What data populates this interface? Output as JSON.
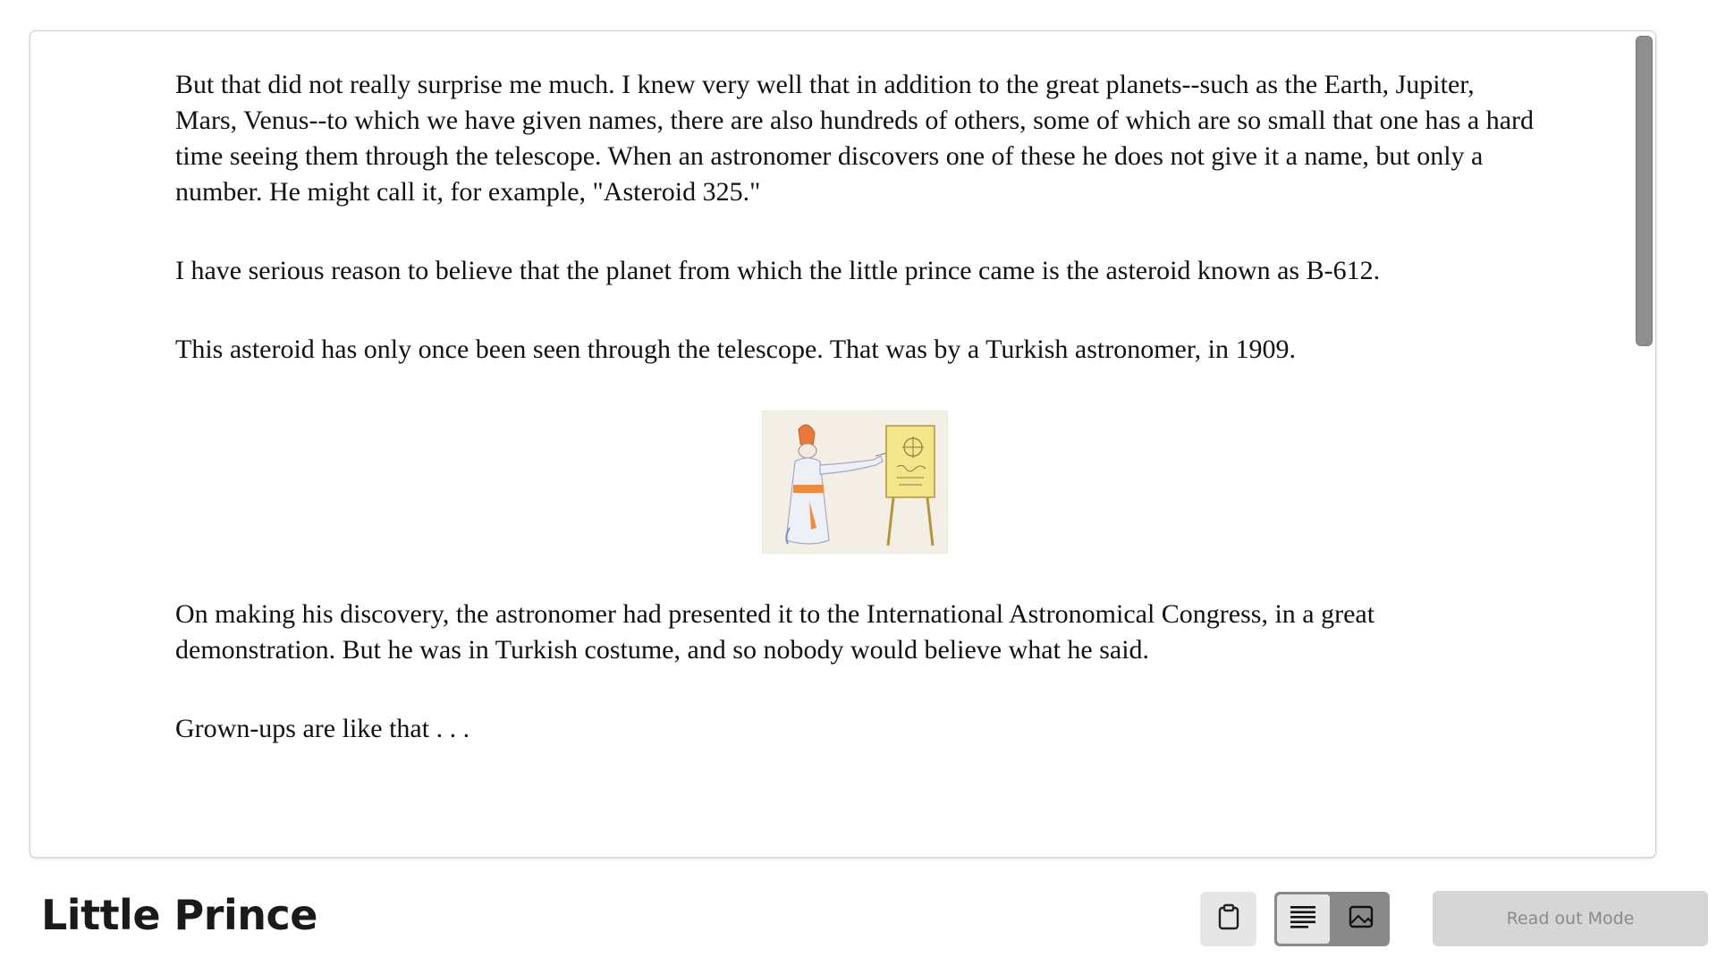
{
  "document": {
    "paragraphs": [
      "But that did not really surprise me much. I knew very well that in addition to the great planets--such as the Earth, Jupiter, Mars, Venus--to which we have given names, there are also hundreds of others, some of which are so small that one has a hard time seeing them through the telescope. When an astronomer discovers one of these he does not give it a name, but only a number. He might call it, for example, \"Asteroid 325.\"",
      "I have serious reason to believe that the planet from which the little prince came is the asteroid known as B-612.",
      "This asteroid has only once been seen through the telescope. That was by a Turkish astronomer, in 1909.",
      "On making his discovery, the astronomer had presented it to the International Astronomical Congress, in a great demonstration. But he was in Turkish costume, and so nobody would believe what he said.",
      "Grown-ups are like that . . ."
    ],
    "figure_icon": "illustration-turkish-astronomer"
  },
  "footer": {
    "title": "Little Prince",
    "clipboard_icon": "clipboard-icon",
    "text_mode_icon": "text-lines-icon",
    "image_mode_icon": "image-icon",
    "read_out_label": "Read out Mode"
  },
  "colors": {
    "button_bg": "#e6e6e6",
    "toggle_bg": "#8a8a8a",
    "read_button_bg": "#d6d6d6",
    "read_button_text": "#8a8a8a"
  }
}
